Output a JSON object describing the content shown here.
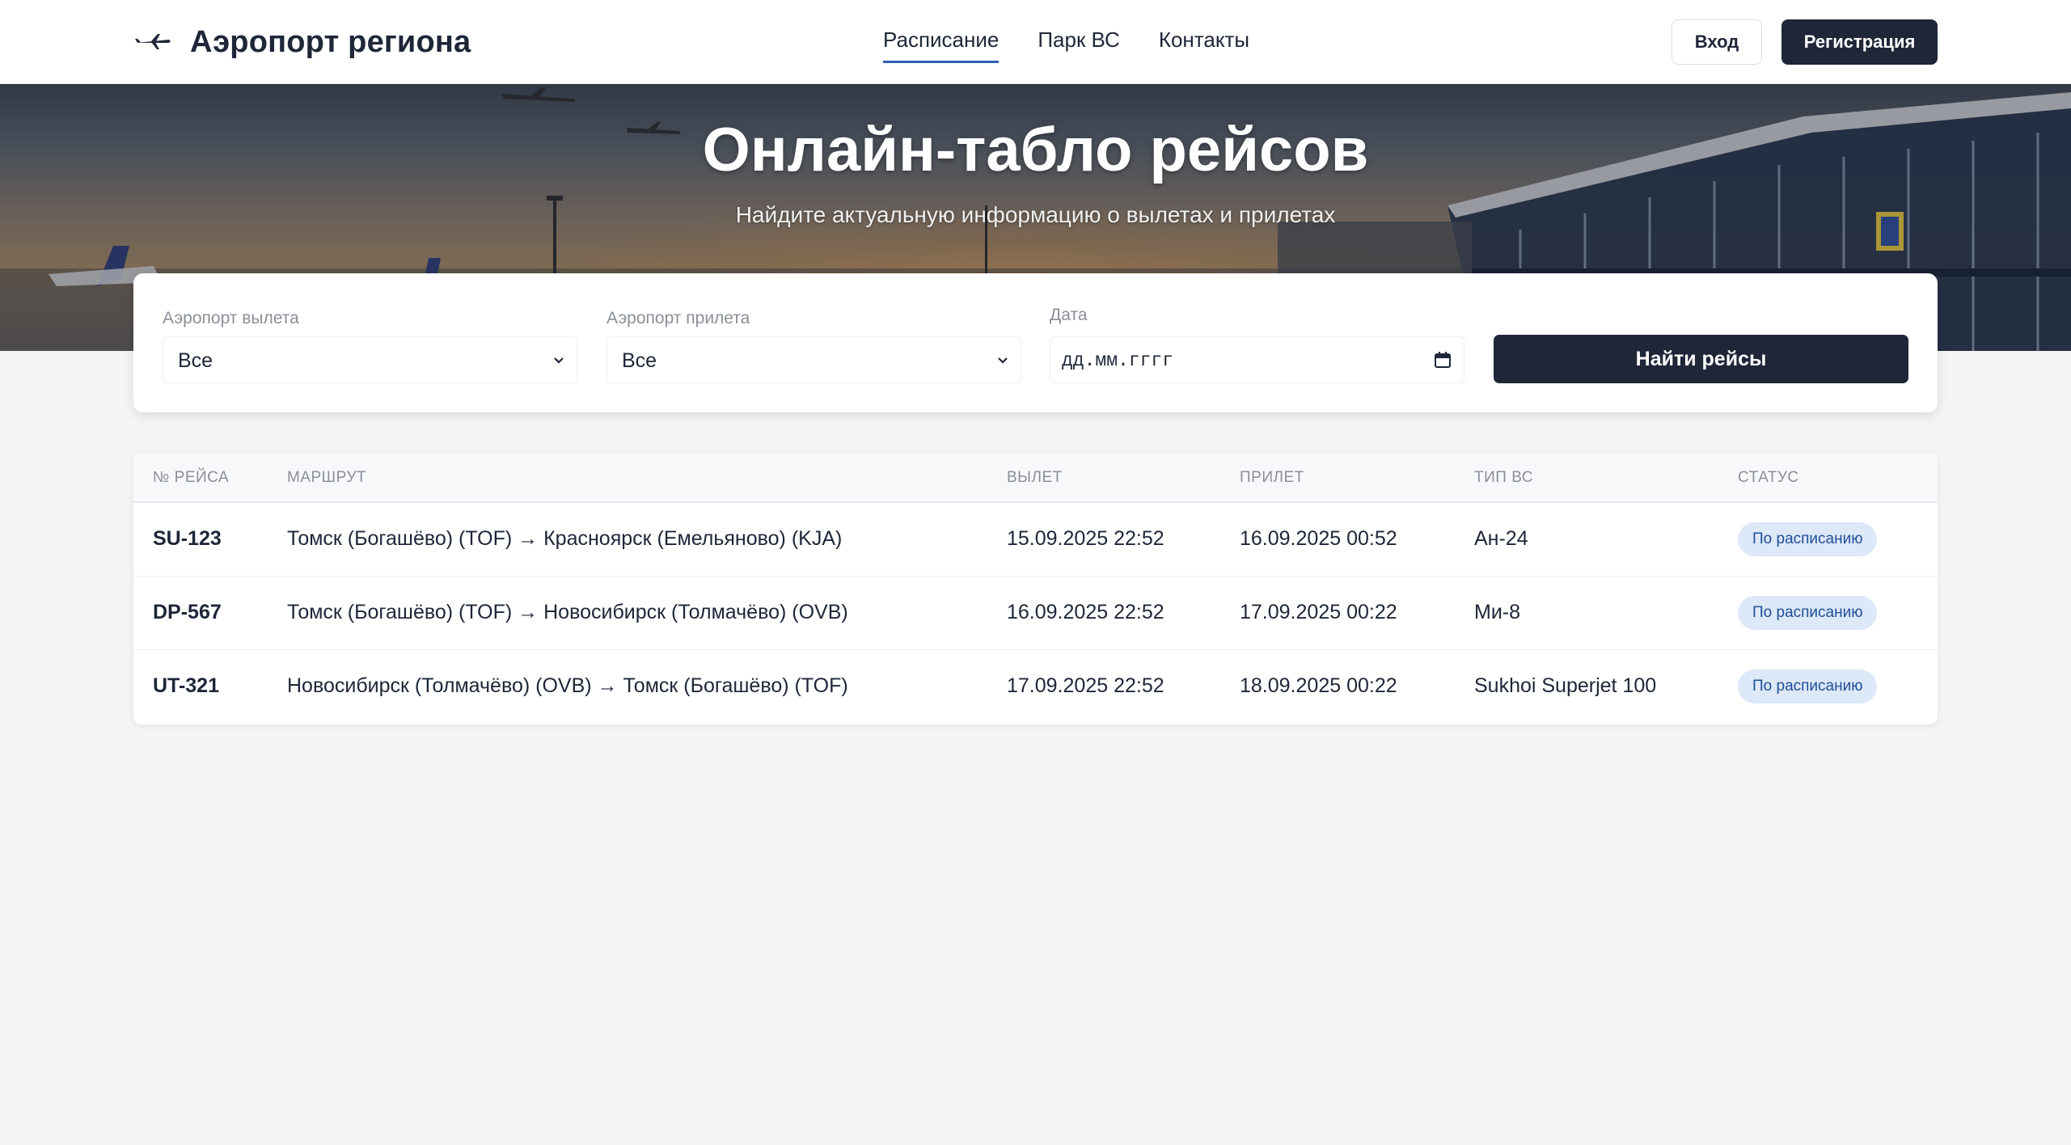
{
  "header": {
    "brand": "Аэропорт региона",
    "logo_icon": "plane-icon",
    "nav": [
      {
        "label": "Расписание",
        "active": true
      },
      {
        "label": "Парк ВС",
        "active": false
      },
      {
        "label": "Контакты",
        "active": false
      }
    ],
    "login_label": "Вход",
    "register_label": "Регистрация"
  },
  "hero": {
    "title": "Онлайн-табло рейсов",
    "subtitle": "Найдите актуальную информацию о вылетах и прилетах"
  },
  "search": {
    "departure_label": "Аэропорт вылета",
    "departure_value": "Все",
    "arrival_label": "Аэропорт прилета",
    "arrival_value": "Все",
    "date_label": "Дата",
    "date_placeholder": "дд.мм.гггг",
    "submit_label": "Найти рейсы"
  },
  "table": {
    "columns": [
      "№ РЕЙСА",
      "МАРШРУТ",
      "ВЫЛЕТ",
      "ПРИЛЕТ",
      "ТИП ВС",
      "СТАТУС"
    ],
    "rows": [
      {
        "flight": "SU-123",
        "route": "Томск (Богашёво) (TOF) → Красноярск (Емельяново) (KJA)",
        "departure": "15.09.2025 22:52",
        "arrival": "16.09.2025 00:52",
        "aircraft": "Ан-24",
        "status": "По расписанию"
      },
      {
        "flight": "DP-567",
        "route": "Томск (Богашёво) (TOF) → Новосибирск (Толмачёво) (OVB)",
        "departure": "16.09.2025 22:52",
        "arrival": "17.09.2025 00:22",
        "aircraft": "Ми-8",
        "status": "По расписанию"
      },
      {
        "flight": "UT-321",
        "route": "Новосибирск (Толмачёво) (OVB) → Томск (Богашёво) (TOF)",
        "departure": "17.09.2025 22:52",
        "arrival": "18.09.2025 00:22",
        "aircraft": "Sukhoi Superjet 100",
        "status": "По расписанию"
      }
    ]
  },
  "colors": {
    "primary": "#1e2638",
    "accent": "#2f5fb0",
    "badge_bg": "#dde8f8",
    "badge_text": "#1f4f98"
  }
}
